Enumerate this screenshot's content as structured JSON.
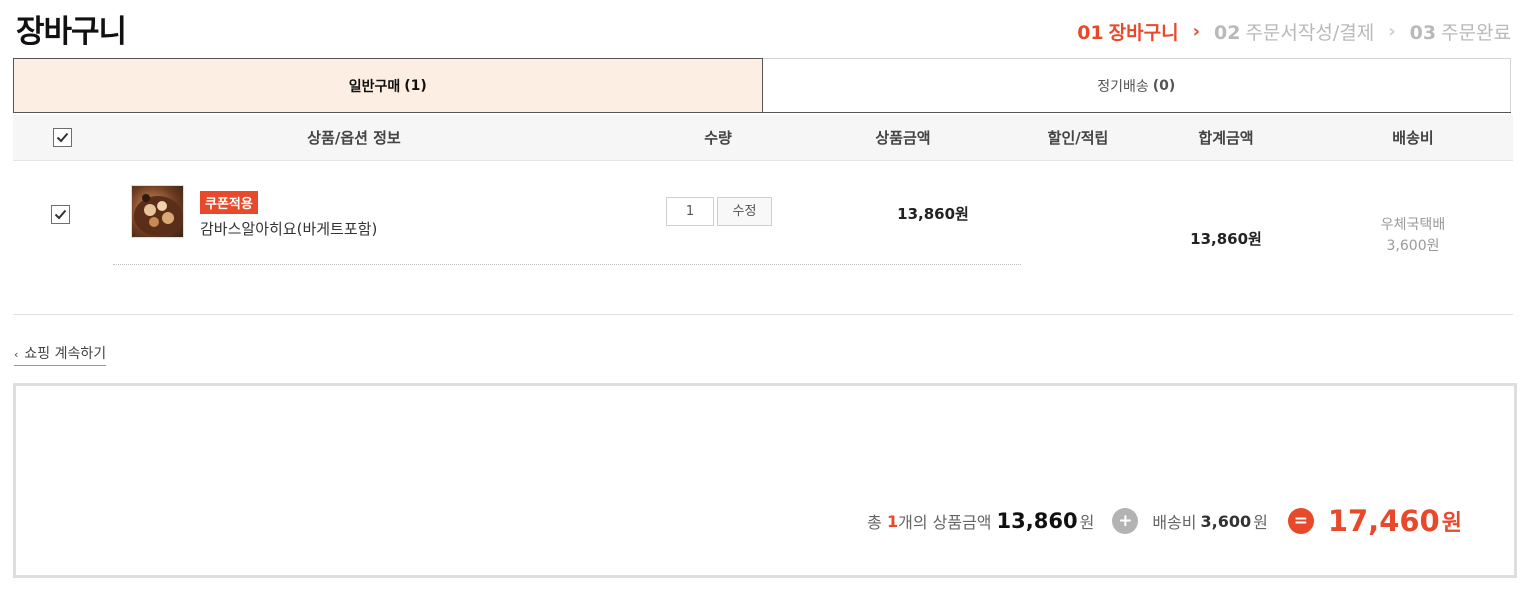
{
  "page_title": "장바구니",
  "steps": [
    {
      "num": "01",
      "label": "장바구니",
      "active": true
    },
    {
      "num": "02",
      "label": "주문서작성/결제",
      "active": false
    },
    {
      "num": "03",
      "label": "주문완료",
      "active": false
    }
  ],
  "tabs": [
    {
      "label": "일반구매",
      "count": "(1)"
    },
    {
      "label": "정기배송",
      "count": "(0)"
    }
  ],
  "table_header": {
    "product_info": "상품/옵션 정보",
    "quantity": "수량",
    "product_price": "상품금액",
    "discount": "할인/적립",
    "total_price": "합계금액",
    "shipping": "배송비"
  },
  "items": [
    {
      "coupon_badge": "쿠폰적용",
      "name": "감바스알아히요(바게트포함)",
      "quantity": "1",
      "modify_label": "수정",
      "price": "13,860원",
      "total": "13,860원",
      "shipping_method": "우체국택배",
      "shipping_fee": "3,600원"
    }
  ],
  "continue_shopping": "쇼핑 계속하기",
  "summary": {
    "prefix": "총",
    "count": "1",
    "count_suffix": "개의 상품금액",
    "product_total": "13,860",
    "unit": "원",
    "shipping_label": "배송비",
    "shipping_total": "3,600",
    "grand_total": "17,460"
  },
  "colors": {
    "accent": "#e8492a",
    "tab_active_bg": "#fdeee3"
  }
}
